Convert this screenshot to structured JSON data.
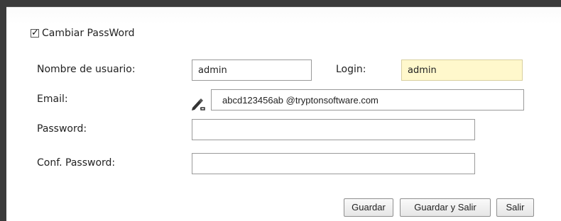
{
  "form": {
    "change_password": {
      "label": "Cambiar PassWord",
      "checked": true
    },
    "username": {
      "label": "Nombre de usuario:",
      "value": "admin"
    },
    "login": {
      "label": "Login:",
      "value": "admin"
    },
    "email": {
      "label": "Email:",
      "value": "abcd123456ab @tryptonsoftware.com",
      "icon": "edit-signature-icon"
    },
    "password": {
      "label": "Password:",
      "value": ""
    },
    "confirm_password": {
      "label": "Conf. Password:",
      "value": ""
    }
  },
  "buttons": {
    "save": "Guardar",
    "save_exit": "Guardar y Salir",
    "exit": "Salir"
  },
  "colors": {
    "frame": "#3b3b3b",
    "readonly_field": "#fff8cc"
  }
}
